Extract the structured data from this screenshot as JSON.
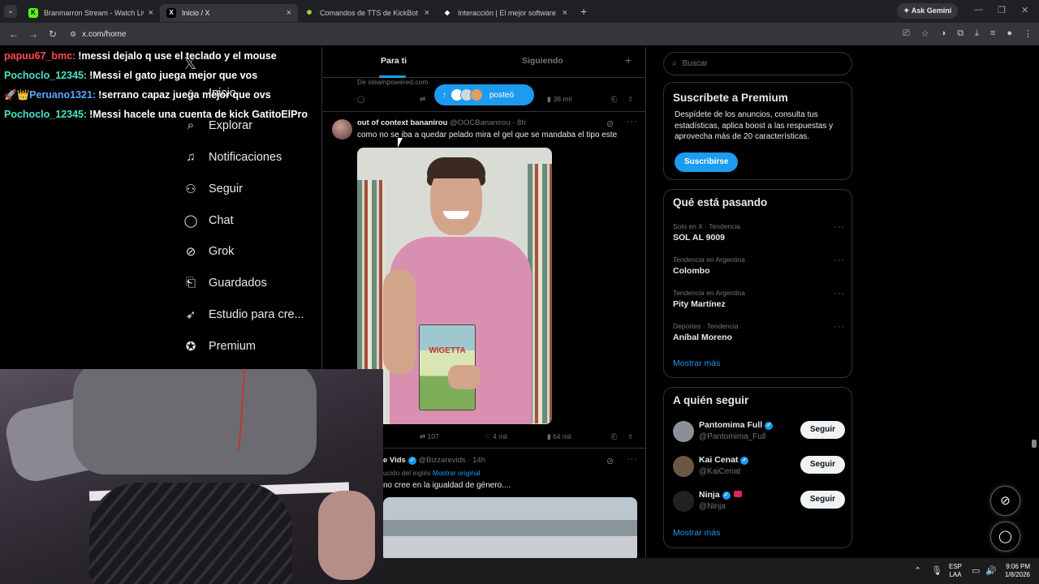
{
  "browser": {
    "tabs": [
      {
        "title": "Branmarron Stream - Watch Liv",
        "favicon": "K",
        "color": "#53fc18"
      },
      {
        "title": "Inicio / X",
        "favicon": "X",
        "color": "#ffffff"
      },
      {
        "title": "Comandos de TTS de KickBot",
        "favicon": "✾",
        "color": "#a3e635"
      },
      {
        "title": "Interacción | El mejor software",
        "favicon": "◆",
        "color": "#ffffff"
      }
    ],
    "ask_gemini": "Ask Gemini",
    "url": "x.com/home"
  },
  "chat": [
    {
      "user": "papuu67_bmc:",
      "user_color": "#ff4d4d",
      "message": "!messi dejalo q use el teclado y el mouse"
    },
    {
      "user": "Pochoclo_12345:",
      "user_color": "#4be3c3",
      "message": "!Messi el gato juega mejor que vos"
    },
    {
      "badges": "🚀👑",
      "user": "Peruano1321:",
      "user_color": "#5aa6ff",
      "message": "!serrano capaz juega mejor que ovs"
    },
    {
      "user": "Pochoclo_12345:",
      "user_color": "#4be3c3",
      "message": "!Messi hacele una cuenta de kick GatitoElPro"
    }
  ],
  "nav": {
    "home_partial": "Inicio",
    "items": [
      {
        "label": "Explorar",
        "icon": "search-icon",
        "glyph": "⌕"
      },
      {
        "label": "Notificaciones",
        "icon": "bell-icon",
        "glyph": "🔔"
      },
      {
        "label": "Seguir",
        "icon": "person-add-icon",
        "glyph": "👤"
      },
      {
        "label": "Chat",
        "icon": "chat-icon",
        "glyph": "💬"
      },
      {
        "label": "Grok",
        "icon": "grok-icon",
        "glyph": "⊘"
      },
      {
        "label": "Guardados",
        "icon": "bookmark-icon",
        "glyph": "🔖"
      },
      {
        "label": "Estudio para cre...",
        "icon": "rocket-icon",
        "glyph": "🚀"
      },
      {
        "label": "Premium",
        "icon": "verified-icon",
        "glyph": "✔"
      }
    ]
  },
  "feed": {
    "tabs": [
      "Para ti",
      "Siguiendo"
    ],
    "prev_tweet": {
      "source": "De steampowered.com",
      "views": "38 mil"
    },
    "posted_label": "posteó",
    "tweet1": {
      "name": "out of context bananirou",
      "handle": "@OOCBananirou · 8h",
      "text": "como no se iba a quedar pelado mira el gel que se mandaba el tipo este",
      "book_title": "WIGETTA",
      "retweets": "107",
      "likes": "4 mil",
      "views": "64 mil"
    },
    "tweet2": {
      "name": "e Vids",
      "handle": "@Bizzarevids · 14h",
      "translated": "ucido del inglés",
      "show_original": "Mostrar original",
      "text": "no cree en la igualdad de género...."
    }
  },
  "sidebar": {
    "search_placeholder": "Buscar",
    "premium": {
      "title": "Suscríbete a Premium",
      "desc": "Despídete de los anuncios, consulta tus estadísticas, aplica boost a las respuestas y aprovecha más de 20 características.",
      "button": "Suscribirse"
    },
    "trends": {
      "title": "Qué está pasando",
      "items": [
        {
          "context": "Solo en X · Tendencia",
          "name": "SOL AL 9009"
        },
        {
          "context": "Tendencia en Argentina",
          "name": "Colombo"
        },
        {
          "context": "Tendencia en Argentina",
          "name": "Pity Martínez"
        },
        {
          "context": "Deportes · Tendencia",
          "name": "Aníbal Moreno"
        }
      ],
      "show_more": "Mostrar más"
    },
    "who_to_follow": {
      "title": "A quién seguir",
      "items": [
        {
          "name": "Pantomima Full",
          "handle": "@Pantomima_Full",
          "button": "Seguir",
          "avatar_color": "#8a8f99"
        },
        {
          "name": "Kai Cenat",
          "handle": "@KaiCenat",
          "button": "Seguir",
          "avatar_color": "#6b5844"
        },
        {
          "name": "Ninja",
          "handle": "@Ninja",
          "button": "Seguir",
          "avatar_color": "#222222"
        }
      ],
      "show_more": "Mostrar más"
    }
  },
  "taskbar": {
    "lang1": "ESP",
    "lang2": "LAA",
    "time": "9:06 PM",
    "date": "1/8/2026"
  }
}
